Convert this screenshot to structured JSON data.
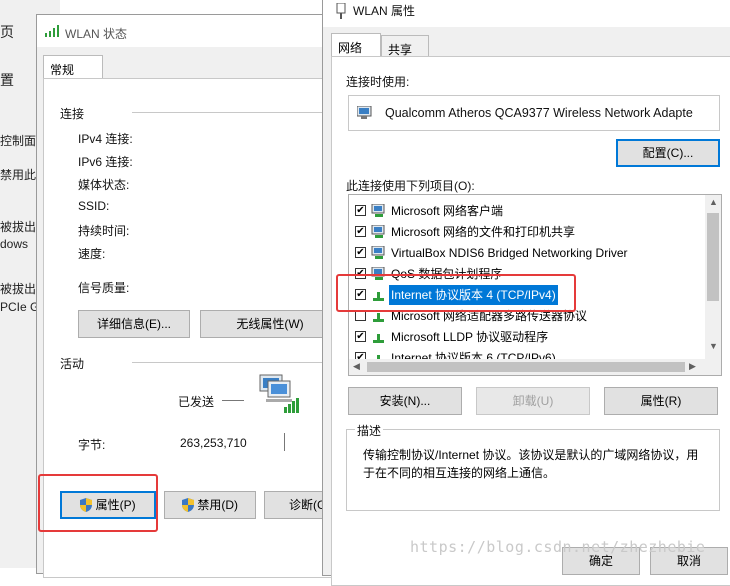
{
  "background_window": {
    "texts": [
      "页",
      "置",
      "控制面板",
      "禁用此",
      "被拔出",
      "dows",
      "被拔出",
      "PCIe G"
    ]
  },
  "status_window": {
    "title": "WLAN 状态",
    "tab": "常规",
    "connection": {
      "heading": "连接",
      "fields": [
        "IPv4 连接:",
        "IPv6 连接:",
        "媒体状态:",
        "SSID:",
        "持续时间:",
        "速度:"
      ],
      "signal_label": "信号质量:"
    },
    "details_button": "详细信息(E)...",
    "wireless_button": "无线属性(W)",
    "activity": {
      "heading": "活动",
      "sent_label": "已发送",
      "bytes_label": "字节:",
      "bytes_sent": "263,253,710"
    },
    "buttons": {
      "properties": "属性(P)",
      "disable": "禁用(D)",
      "diagnose": "诊断(G)"
    }
  },
  "properties_window": {
    "title": "WLAN 属性",
    "tabs": [
      "网络",
      "共享"
    ],
    "connect_using_label": "连接时使用:",
    "adapter_name": "Qualcomm Atheros QCA9377 Wireless Network Adapte",
    "configure_button": "配置(C)...",
    "items_label": "此连接使用下列项目(O):",
    "items": [
      {
        "label": "Microsoft 网络客户端",
        "checked": true
      },
      {
        "label": "Microsoft 网络的文件和打印机共享",
        "checked": true
      },
      {
        "label": "VirtualBox NDIS6 Bridged Networking Driver",
        "checked": true
      },
      {
        "label": "QoS 数据包计划程序",
        "checked": true
      },
      {
        "label": "Internet 协议版本 4 (TCP/IPv4)",
        "checked": true,
        "selected": true
      },
      {
        "label": "Microsoft 网络适配器多路传送器协议",
        "checked": false
      },
      {
        "label": "Microsoft LLDP 协议驱动程序",
        "checked": true
      },
      {
        "label": "Internet 协议版本 6 (TCP/IPv6)",
        "checked": true
      }
    ],
    "install_button": "安装(N)...",
    "uninstall_button": "卸载(U)",
    "properties_button": "属性(R)",
    "description_heading": "描述",
    "description_text": "传输控制协议/Internet 协议。该协议是默认的广域网络协议，用于在不同的相互连接的网络上通信。",
    "ok_button": "确定",
    "cancel_button": "取消"
  },
  "watermark": "https://blog.csdn.net/zhezhebie",
  "colors": {
    "selection": "#0078d7",
    "annotation_box": "#e53a3a",
    "checkbox": "#333333"
  }
}
